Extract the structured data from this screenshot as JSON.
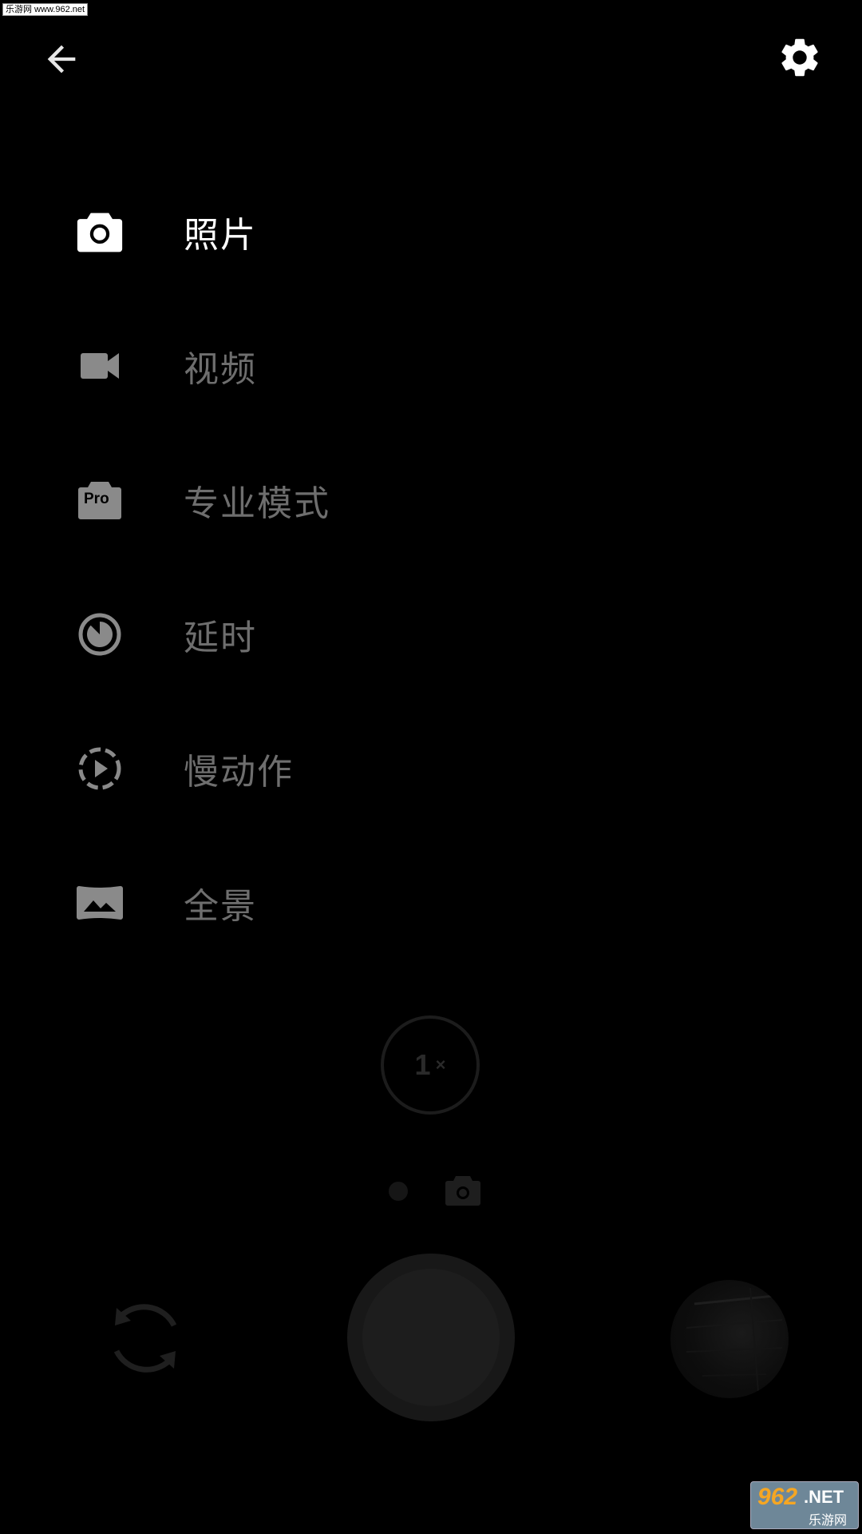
{
  "watermark_top": "乐游网 www.962.net",
  "modes": [
    {
      "label": "照片",
      "icon": "camera-icon",
      "active": true
    },
    {
      "label": "视频",
      "icon": "videocam-icon",
      "active": false
    },
    {
      "label": "专业模式",
      "icon": "pro-camera-icon",
      "pro_badge": "Pro",
      "active": false
    },
    {
      "label": "延时",
      "icon": "timelapse-icon",
      "active": false
    },
    {
      "label": "慢动作",
      "icon": "slow-motion-icon",
      "active": false
    },
    {
      "label": "全景",
      "icon": "panorama-icon",
      "active": false
    }
  ],
  "zoom": {
    "value": "1",
    "suffix": "×"
  },
  "watermark_bottom": {
    "number": "962",
    "net": ".NET",
    "cn": "乐游网"
  },
  "colors": {
    "background": "#000000",
    "active_label": "#ffffff",
    "inactive_label": "#6e6e6e",
    "inactive_icon": "#8a8a8a"
  }
}
